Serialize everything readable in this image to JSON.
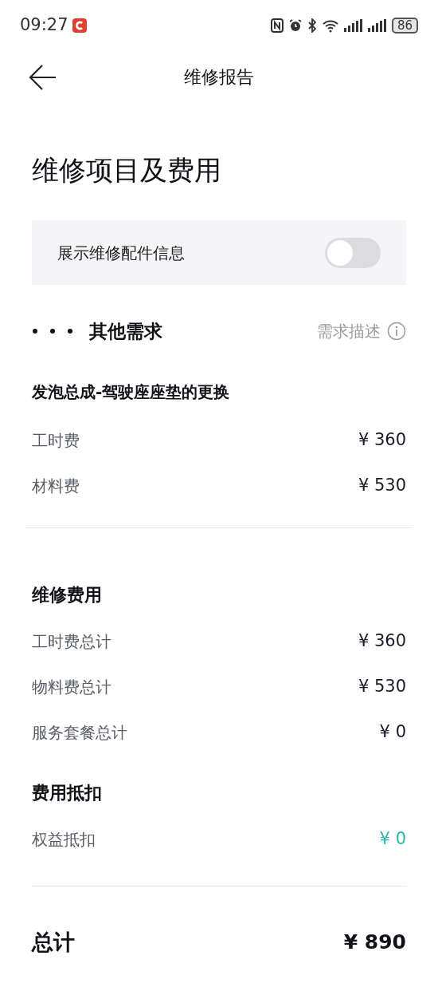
{
  "status_bar": {
    "time": "09:27",
    "battery": "86"
  },
  "header": {
    "title": "维修报告"
  },
  "page_title": "维修项目及费用",
  "toggle": {
    "label": "展示维修配件信息",
    "on": false
  },
  "demand": {
    "title": "其他需求",
    "link": "需求描述"
  },
  "item": {
    "title": "发泡总成-驾驶座座垫的更换",
    "rows": [
      {
        "label": "工时费",
        "amount": "¥ 360",
        "kind": "charge"
      },
      {
        "label": "材料费",
        "amount": "¥ 530",
        "kind": "charge"
      }
    ]
  },
  "groups": [
    {
      "title": "维修费用",
      "rows": [
        {
          "label": "工时费总计",
          "amount": "¥ 360",
          "kind": "charge"
        },
        {
          "label": "物料费总计",
          "amount": "¥ 530",
          "kind": "charge"
        },
        {
          "label": "服务套餐总计",
          "amount": "¥ 0",
          "kind": "charge"
        }
      ]
    },
    {
      "title": "费用抵扣",
      "rows": [
        {
          "label": "权益抵扣",
          "amount": "¥ 0",
          "kind": "deduction"
        }
      ]
    }
  ],
  "total": {
    "label": "总计",
    "amount": "¥ 890"
  }
}
